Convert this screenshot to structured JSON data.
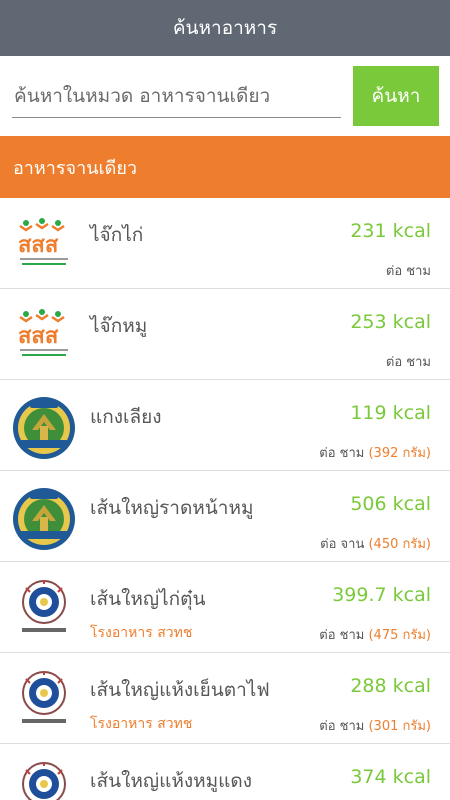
{
  "header": {
    "title": "ค้นหาอาหาร"
  },
  "search": {
    "placeholder": "ค้นหาในหมวด อาหารจานเดียว",
    "value": "",
    "button_label": "ค้นหา"
  },
  "category": {
    "label": "อาหารจานเดียว"
  },
  "colors": {
    "accent_green": "#7ac93a",
    "accent_orange": "#ee7e2d",
    "header_gray": "#5f6873"
  },
  "items": [
    {
      "name": "ไจ๊กไก่",
      "kcal": "231 kcal",
      "unit": "ต่อ ชาม",
      "grams": "",
      "source": "",
      "logo": "thaihealth-logo"
    },
    {
      "name": "ไจ๊กหมู",
      "kcal": "253 kcal",
      "unit": "ต่อ ชาม",
      "grams": "",
      "source": "",
      "logo": "thaihealth-logo"
    },
    {
      "name": "แกงเลียง",
      "kcal": "119 kcal",
      "unit": "ต่อ ชาม",
      "grams": "(392 กรัม)",
      "source": "",
      "logo": "health-dept-seal"
    },
    {
      "name": "เส้นใหญ่ราดหน้าหมู",
      "kcal": "506 kcal",
      "unit": "ต่อ จาน",
      "grams": "(450 กรัม)",
      "source": "",
      "logo": "health-dept-seal"
    },
    {
      "name": "เส้นใหญ่ไก่ตุ๋น",
      "kcal": "399.7 kcal",
      "unit": "ต่อ ชาม",
      "grams": "(475 กรัม)",
      "source": "โรงอาหาร สวทช",
      "logo": "nutrition-institute-logo"
    },
    {
      "name": "เส้นใหญ่แห้งเย็นตาไฟ",
      "kcal": "288 kcal",
      "unit": "ต่อ ชาม",
      "grams": "(301 กรัม)",
      "source": "โรงอาหาร สวทช",
      "logo": "nutrition-institute-logo"
    },
    {
      "name": "เส้นใหญ่แห้งหมูแดง",
      "kcal": "374 kcal",
      "unit": "",
      "grams": "",
      "source": "",
      "logo": "nutrition-institute-logo"
    }
  ]
}
